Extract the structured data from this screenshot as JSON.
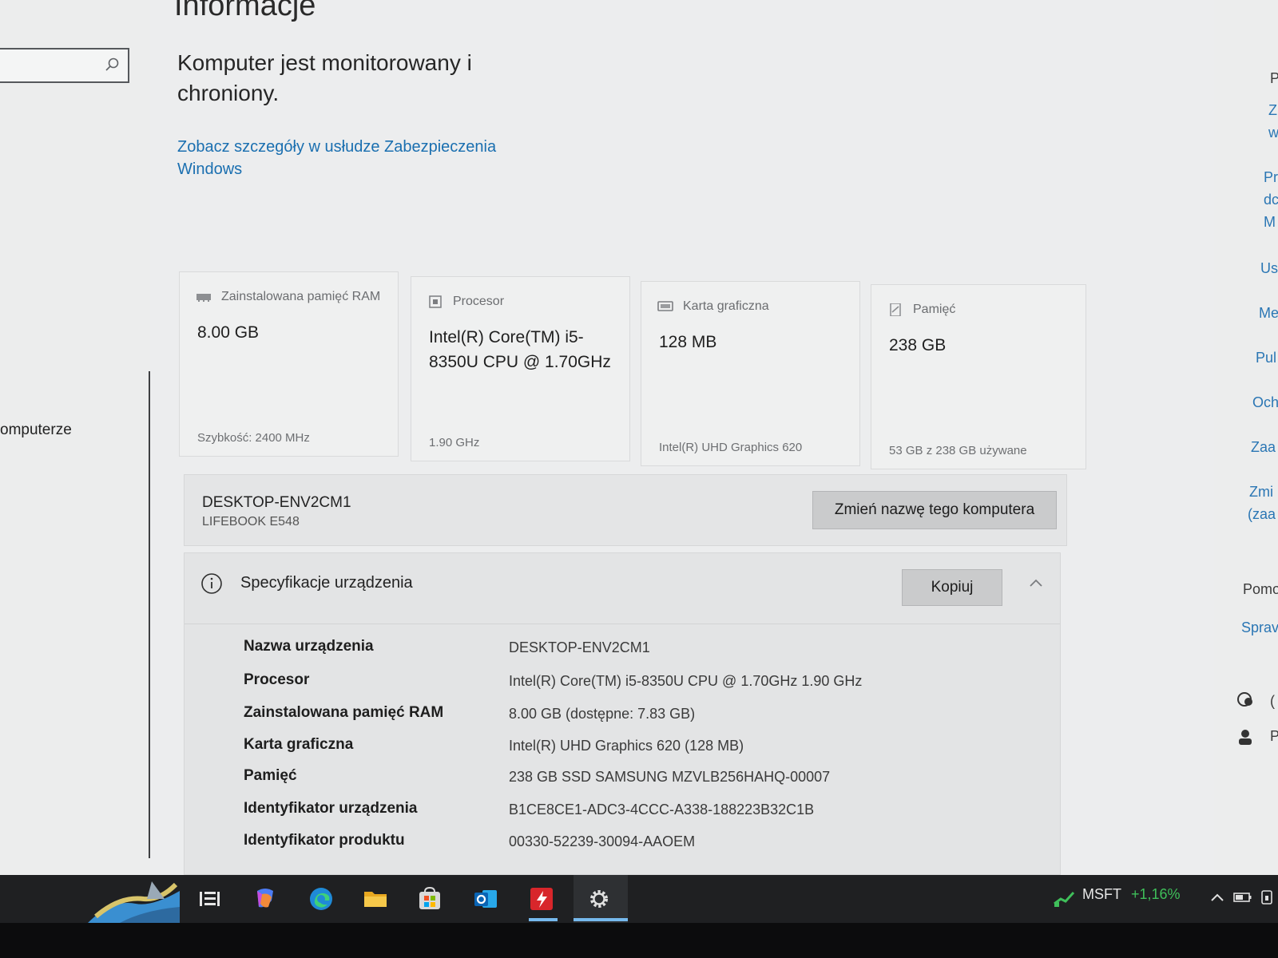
{
  "sidebar": {
    "search": {
      "placeholder": ""
    },
    "partial_item": "omputerze"
  },
  "main": {
    "title": "Informacje",
    "security_status": "Komputer jest monitorowany i chroniony.",
    "security_link": "Zobacz szczegóły w usłudze Zabezpieczenia Windows",
    "cards": [
      {
        "label": "Zainstalowana pamięć RAM",
        "value": "8.00 GB",
        "sub": "Szybkość: 2400 MHz",
        "icon": "ram-icon"
      },
      {
        "label": "Procesor",
        "value": "Intel(R) Core(TM) i5-8350U CPU @ 1.70GHz",
        "sub": "1.90 GHz",
        "icon": "cpu-icon"
      },
      {
        "label": "Karta graficzna",
        "value": "128 MB",
        "sub": "Intel(R) UHD Graphics 620",
        "icon": "gpu-icon"
      },
      {
        "label": "Pamięć",
        "value": "238 GB",
        "sub": "53 GB z 238 GB używane",
        "icon": "storage-icon"
      }
    ],
    "device": {
      "name": "DESKTOP-ENV2CM1",
      "model": "LIFEBOOK E548",
      "rename_button": "Zmień nazwę tego komputera"
    },
    "specs": {
      "title": "Specyfikacje urządzenia",
      "copy_button": "Kopiuj",
      "rows": [
        {
          "label": "Nazwa urządzenia",
          "value": "DESKTOP-ENV2CM1"
        },
        {
          "label": "Procesor",
          "value": "Intel(R) Core(TM) i5-8350U CPU @ 1.70GHz   1.90 GHz"
        },
        {
          "label": "Zainstalowana pamięć RAM",
          "value": "8.00 GB (dostępne: 7.83 GB)"
        },
        {
          "label": "Karta graficzna",
          "value": "Intel(R) UHD Graphics 620 (128 MB)"
        },
        {
          "label": "Pamięć",
          "value": "238 GB SSD SAMSUNG MZVLB256HAHQ-00007"
        },
        {
          "label": "Identyfikator urządzenia",
          "value": "B1CE8CE1-ADC3-4CCC-A338-188223B32C1B"
        },
        {
          "label": "Identyfikator produktu",
          "value": "00330-52239-30094-AAOEM"
        }
      ]
    }
  },
  "right_rail": {
    "items": [
      "P",
      "Z",
      "w",
      "Pr",
      "dc",
      "M",
      "Us",
      "Me",
      "Pul",
      "Och",
      "Zaa",
      "Zmi",
      "(zaa",
      "Pomo",
      "Sprav",
      "(",
      "P"
    ]
  },
  "taskbar": {
    "ticker_symbol": "MSFT",
    "ticker_change": "+1,16%",
    "colors": {
      "ticker_up": "#3fbf5a",
      "active_indicator": "#76b9ed",
      "link": "#1a6fb0"
    }
  }
}
